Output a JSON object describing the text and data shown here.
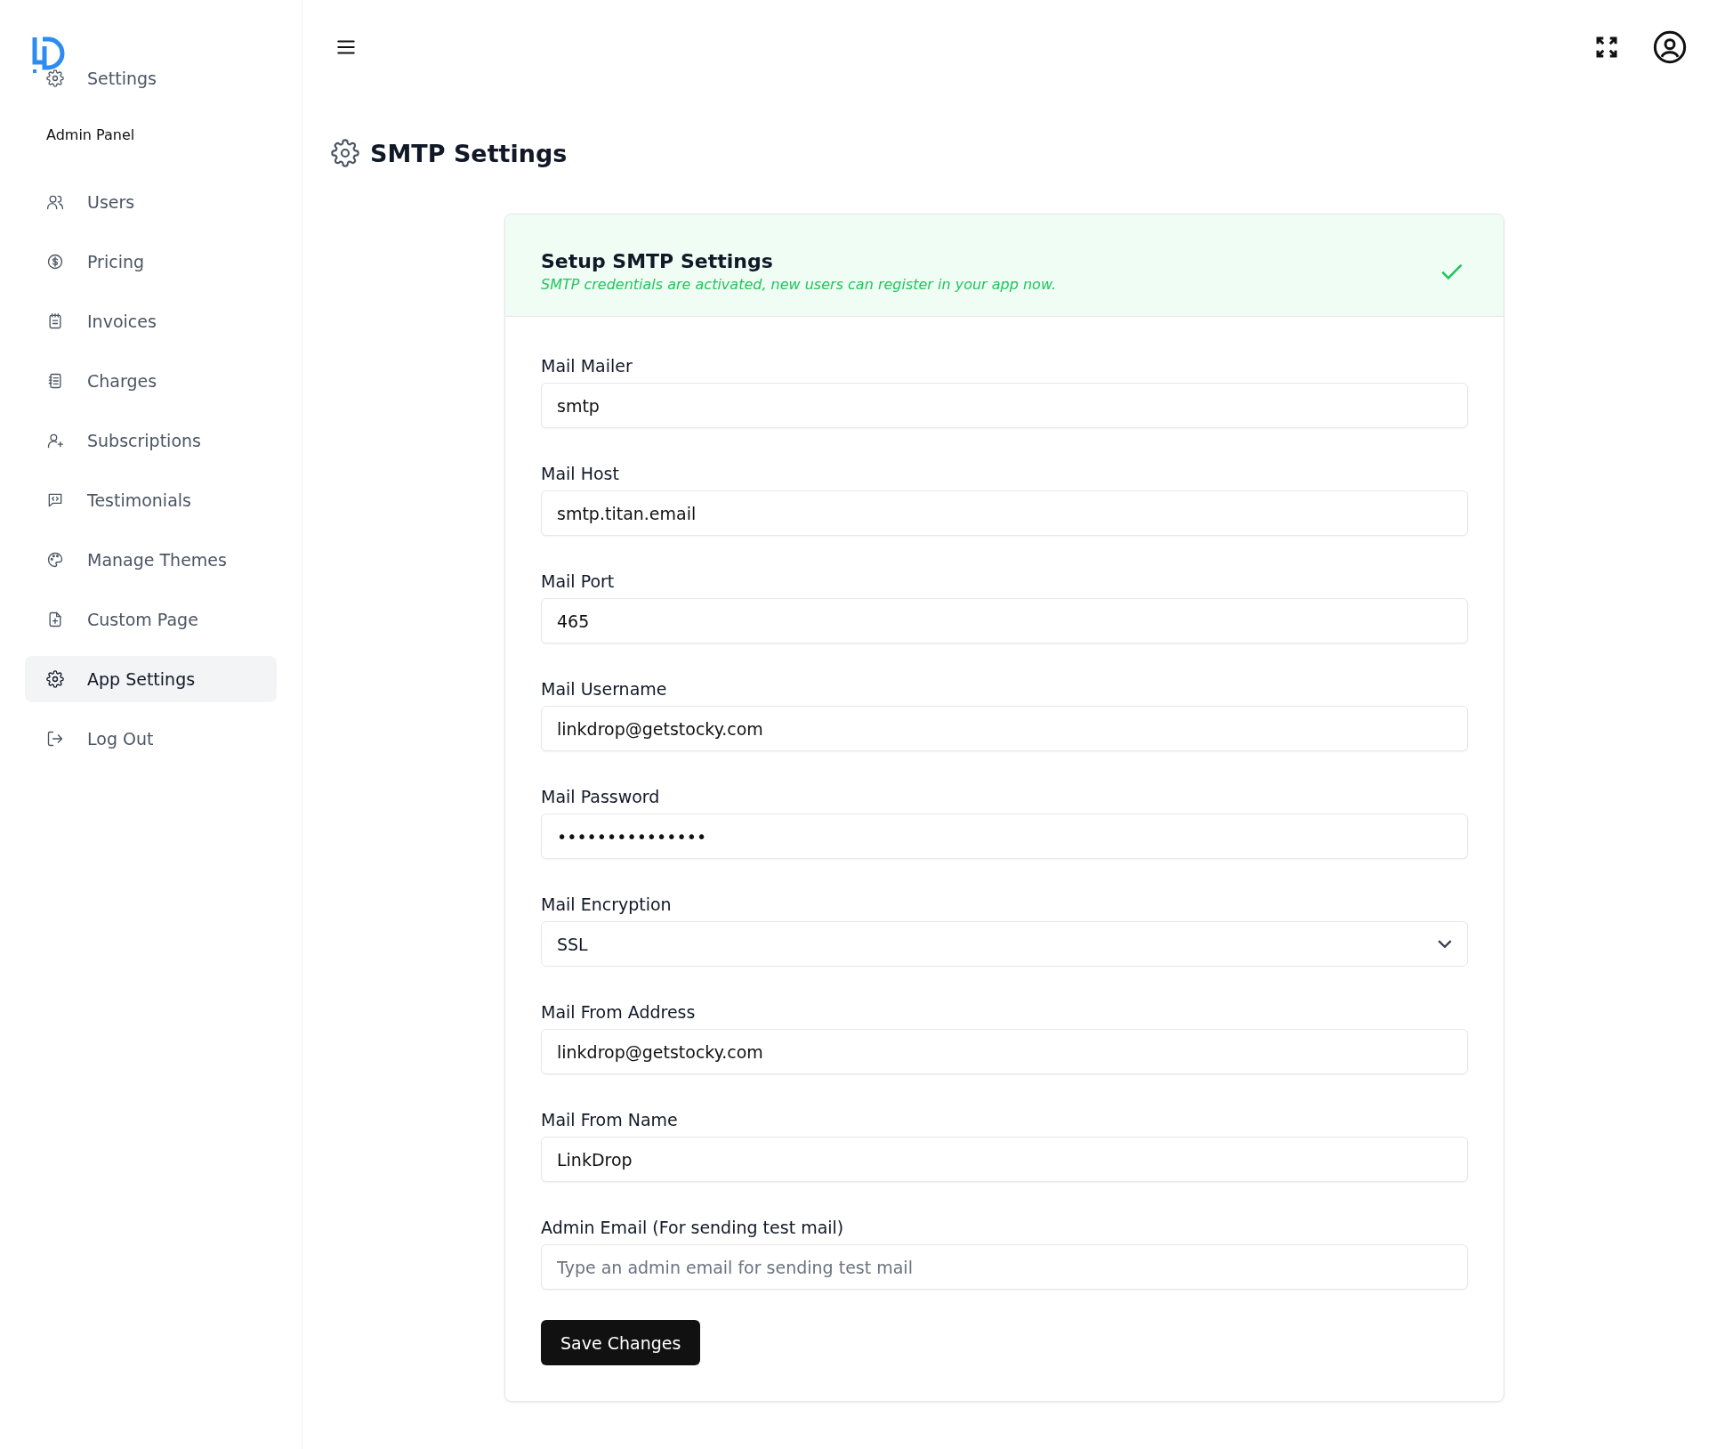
{
  "sidebar": {
    "top_item": {
      "label": "Settings"
    },
    "section_title": "Admin Panel",
    "items": [
      {
        "label": "Users",
        "selected": false
      },
      {
        "label": "Pricing",
        "selected": false
      },
      {
        "label": "Invoices",
        "selected": false
      },
      {
        "label": "Charges",
        "selected": false
      },
      {
        "label": "Subscriptions",
        "selected": false
      },
      {
        "label": "Testimonials",
        "selected": false
      },
      {
        "label": "Manage Themes",
        "selected": false
      },
      {
        "label": "Custom Page",
        "selected": false
      },
      {
        "label": "App Settings",
        "selected": true
      }
    ],
    "logout": {
      "label": "Log Out"
    }
  },
  "page_title": "SMTP Settings",
  "card": {
    "title": "Setup SMTP Settings",
    "subtitle": "SMTP credentials are activated, new users can register in your app now.",
    "activated": true,
    "fields": [
      {
        "kind": "text",
        "label": "Mail Mailer",
        "value": "smtp"
      },
      {
        "kind": "text",
        "label": "Mail Host",
        "value": "smtp.titan.email"
      },
      {
        "kind": "text",
        "label": "Mail Port",
        "value": "465"
      },
      {
        "kind": "text",
        "label": "Mail Username",
        "value": "linkdrop@getstocky.com"
      },
      {
        "kind": "text",
        "label": "Mail Password",
        "value": "•••••••••••••••"
      },
      {
        "kind": "select",
        "label": "Mail Encryption",
        "value": "SSL"
      },
      {
        "kind": "text",
        "label": "Mail From Address",
        "value": "linkdrop@getstocky.com"
      },
      {
        "kind": "text",
        "label": "Mail From Name",
        "value": "LinkDrop"
      },
      {
        "kind": "text",
        "label": "Admin Email (For sending test mail)",
        "placeholder": "Type an admin email for sending test mail"
      }
    ],
    "save_button": "Save Changes"
  }
}
